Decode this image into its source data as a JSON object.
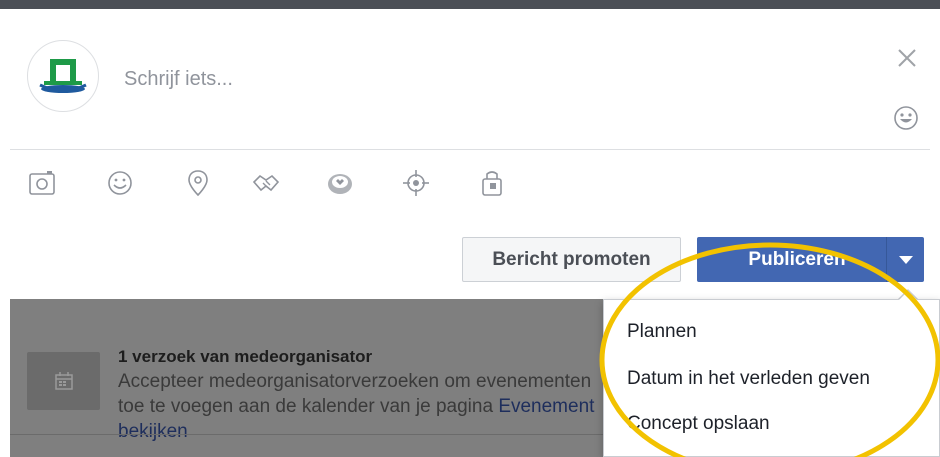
{
  "composer": {
    "placeholder": "Schrijf iets...",
    "avatar_icon": "page-logo",
    "close_icon": "close-icon",
    "emoji_icon": "smiley-icon"
  },
  "attachments": [
    {
      "icon": "camera-icon"
    },
    {
      "icon": "feeling-smiley-icon"
    },
    {
      "icon": "location-pin-icon"
    },
    {
      "icon": "handshake-icon"
    },
    {
      "icon": "badge-icon"
    },
    {
      "icon": "target-icon"
    },
    {
      "icon": "shopping-bag-icon"
    }
  ],
  "actions": {
    "promote_label": "Bericht promoten",
    "publish_label": "Publiceren",
    "dropdown_icon": "chevron-down-icon"
  },
  "dropdown_menu": {
    "items": [
      "Plannen",
      "Datum in het verleden geven",
      "Concept opslaan"
    ]
  },
  "event_request": {
    "title": "1 verzoek van medeorganisator",
    "text": "Accepteer medeorganisatorverzoeken om evenementen toe te voegen aan de kalender van je pagina",
    "link": "Evenement bekijken",
    "icon": "calendar-icon"
  },
  "colors": {
    "primary_button": "#4267b2",
    "top_bar": "#4b4f56",
    "highlight_ring": "#f2c200",
    "overlay": "#7f7f7f"
  }
}
